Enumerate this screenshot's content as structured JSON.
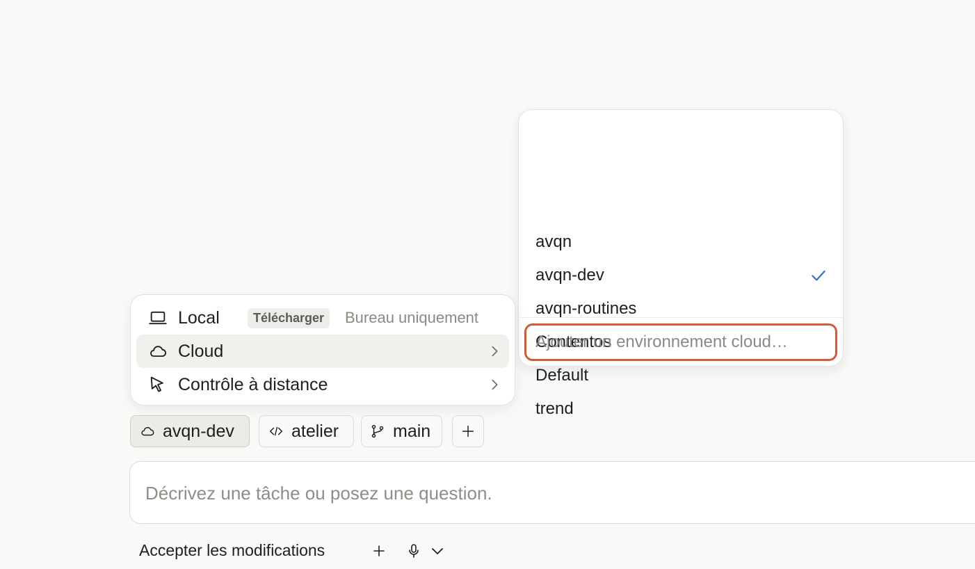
{
  "environments": {
    "items": [
      {
        "label": "avqn",
        "selected": false
      },
      {
        "label": "avqn-dev",
        "selected": true
      },
      {
        "label": "avqn-routines",
        "selected": false
      },
      {
        "label": "Contentos",
        "selected": false
      },
      {
        "label": "Default",
        "selected": false
      },
      {
        "label": "trend",
        "selected": false
      }
    ],
    "add_label": "Ajouter un environnement cloud…",
    "check_color": "#2d6fd6",
    "highlight_color": "#d45a35"
  },
  "location_menu": {
    "local": {
      "label": "Local",
      "badge": "Télécharger",
      "note": "Bureau uniquement",
      "icon": "laptop-icon"
    },
    "cloud": {
      "label": "Cloud",
      "icon": "cloud-icon"
    },
    "remote": {
      "label": "Contrôle à distance",
      "icon": "cursor-icon"
    }
  },
  "chips": {
    "environment": {
      "label": "avqn-dev",
      "icon": "cloud-icon"
    },
    "repo": {
      "label": "atelier",
      "icon": "code-icon"
    },
    "branch": {
      "label": "main",
      "icon": "branch-icon"
    },
    "add": {
      "icon": "plus-icon"
    }
  },
  "prompt": {
    "placeholder": "Décrivez une tâche ou posez une question.",
    "value": ""
  },
  "toolbar": {
    "accept_label": "Accepter les modifications"
  }
}
